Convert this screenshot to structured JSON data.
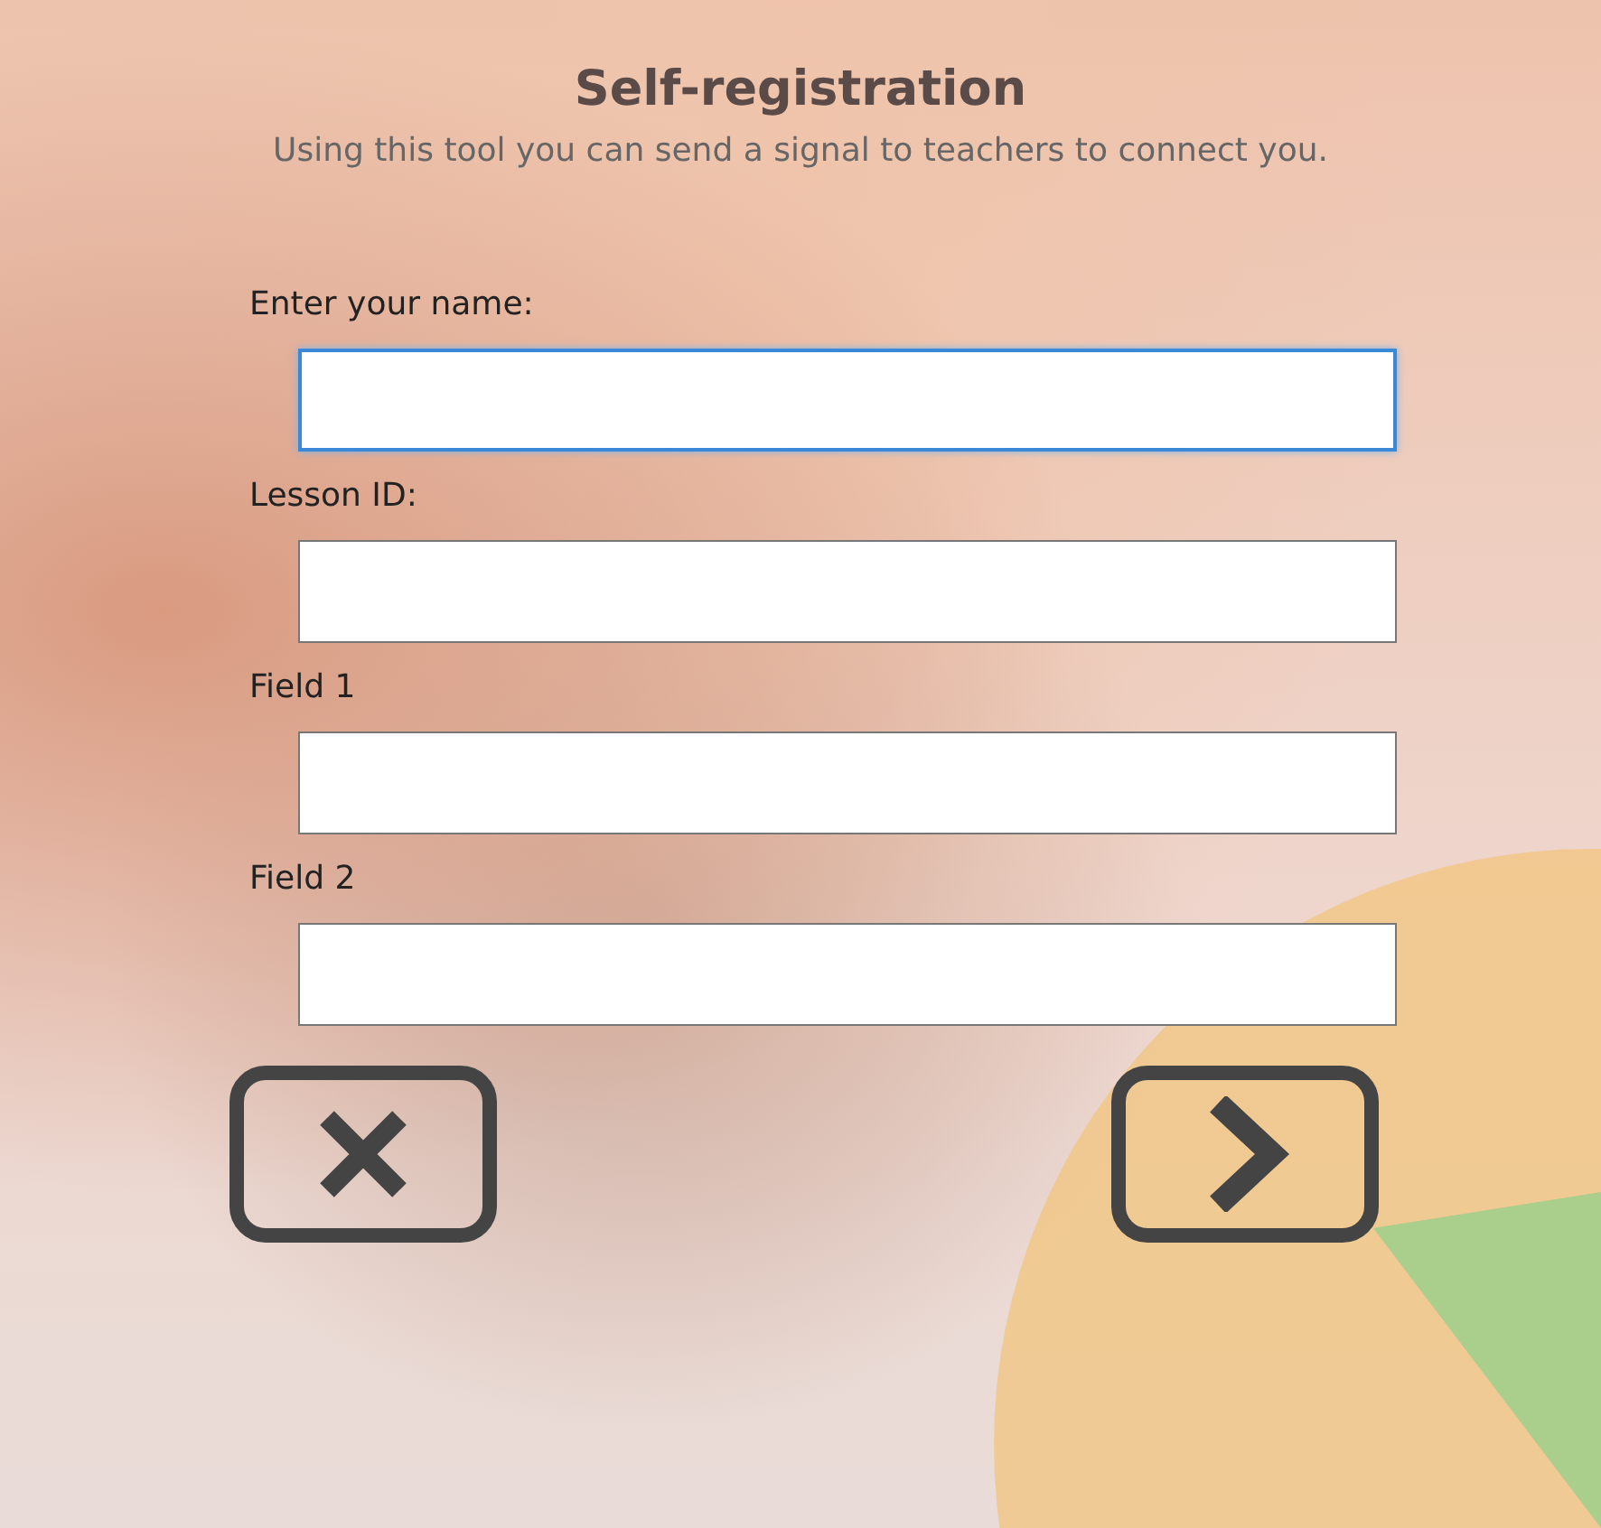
{
  "title": "Self-registration",
  "subtitle": "Using this tool you can send a signal to teachers to connect you.",
  "fields": [
    {
      "label": "Enter your name:",
      "focused": true
    },
    {
      "label": "Lesson ID:",
      "focused": false
    },
    {
      "label": "Field 1",
      "focused": false
    },
    {
      "label": "Field 2",
      "focused": false
    }
  ],
  "buttons": [
    {
      "kind": "cancel"
    },
    {
      "kind": "next"
    }
  ]
}
